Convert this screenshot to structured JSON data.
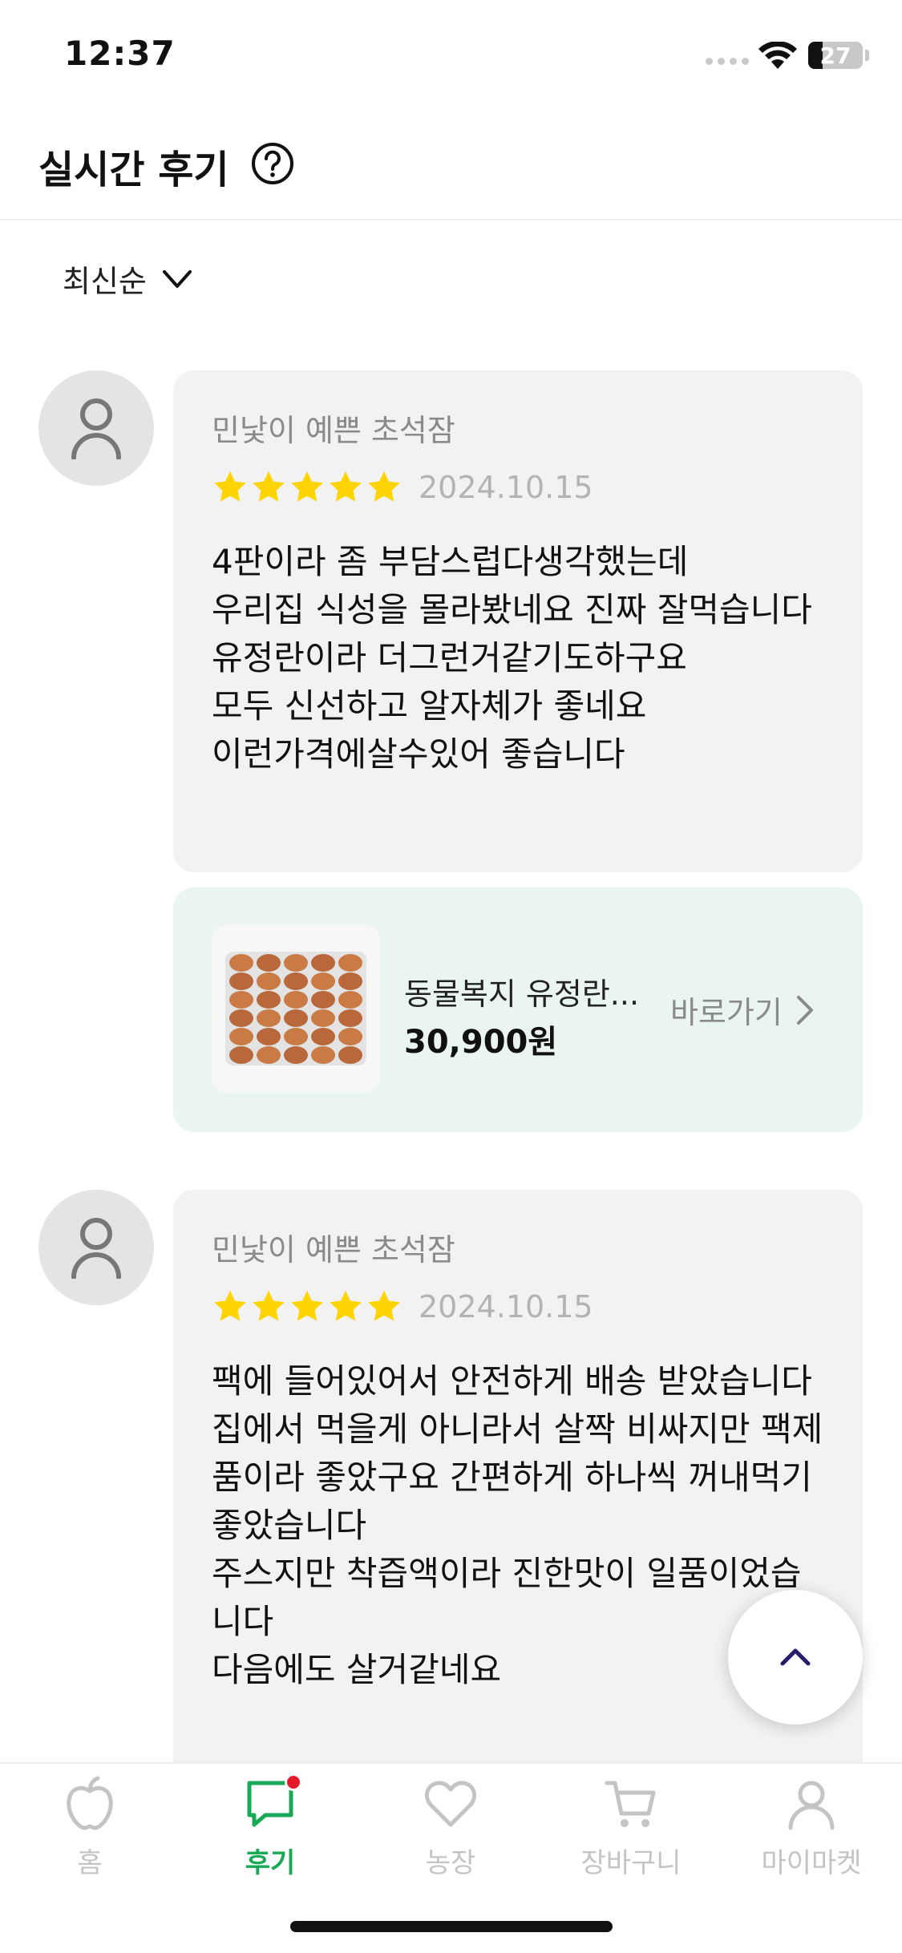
{
  "status_bar": {
    "time": "12:37",
    "battery": "27"
  },
  "header": {
    "title": "실시간 후기",
    "help_icon": "question-circle-icon"
  },
  "sort": {
    "label": "최신순"
  },
  "reviews": [
    {
      "name": "민낯이 예쁜 초석잠",
      "rating": 5,
      "date": "2024.10.15",
      "text": "4판이라 좀 부담스럽다생각했는데\n우리집 식성을 몰라봤네요 진짜 잘먹습니다\n유정란이라 더그런거같기도하구요\n모두 신선하고 알자체가 좋네요\n이런가격에살수있어 좋습니다",
      "product": {
        "name": "동물복지 유정란...",
        "price": "30,900원",
        "goto_label": "바로가기"
      }
    },
    {
      "name": "민낯이 예쁜 초석잠",
      "rating": 5,
      "date": "2024.10.15",
      "text": "팩에 들어있어서 안전하게 배송 받았습니다\n집에서 먹을게 아니라서 살짝 비싸지만 팩제품이라 좋았구요 간편하게 하나씩 꺼내먹기좋았습니다\n주스지만 착즙액이라 진한맛이 일품이었습니다\n다음에도 살거같네요"
    }
  ],
  "tabs": [
    {
      "label": "홈",
      "icon": "apple-icon",
      "active": false
    },
    {
      "label": "후기",
      "icon": "chat-bubble-icon",
      "active": true
    },
    {
      "label": "농장",
      "icon": "heart-icon",
      "active": false
    },
    {
      "label": "장바구니",
      "icon": "cart-icon",
      "active": false
    },
    {
      "label": "마이마켓",
      "icon": "person-icon",
      "active": false
    }
  ],
  "colors": {
    "accent": "#18a957",
    "star": "#ffd400",
    "badge": "#e6192b",
    "fab_arrow": "#2a1a6e"
  }
}
